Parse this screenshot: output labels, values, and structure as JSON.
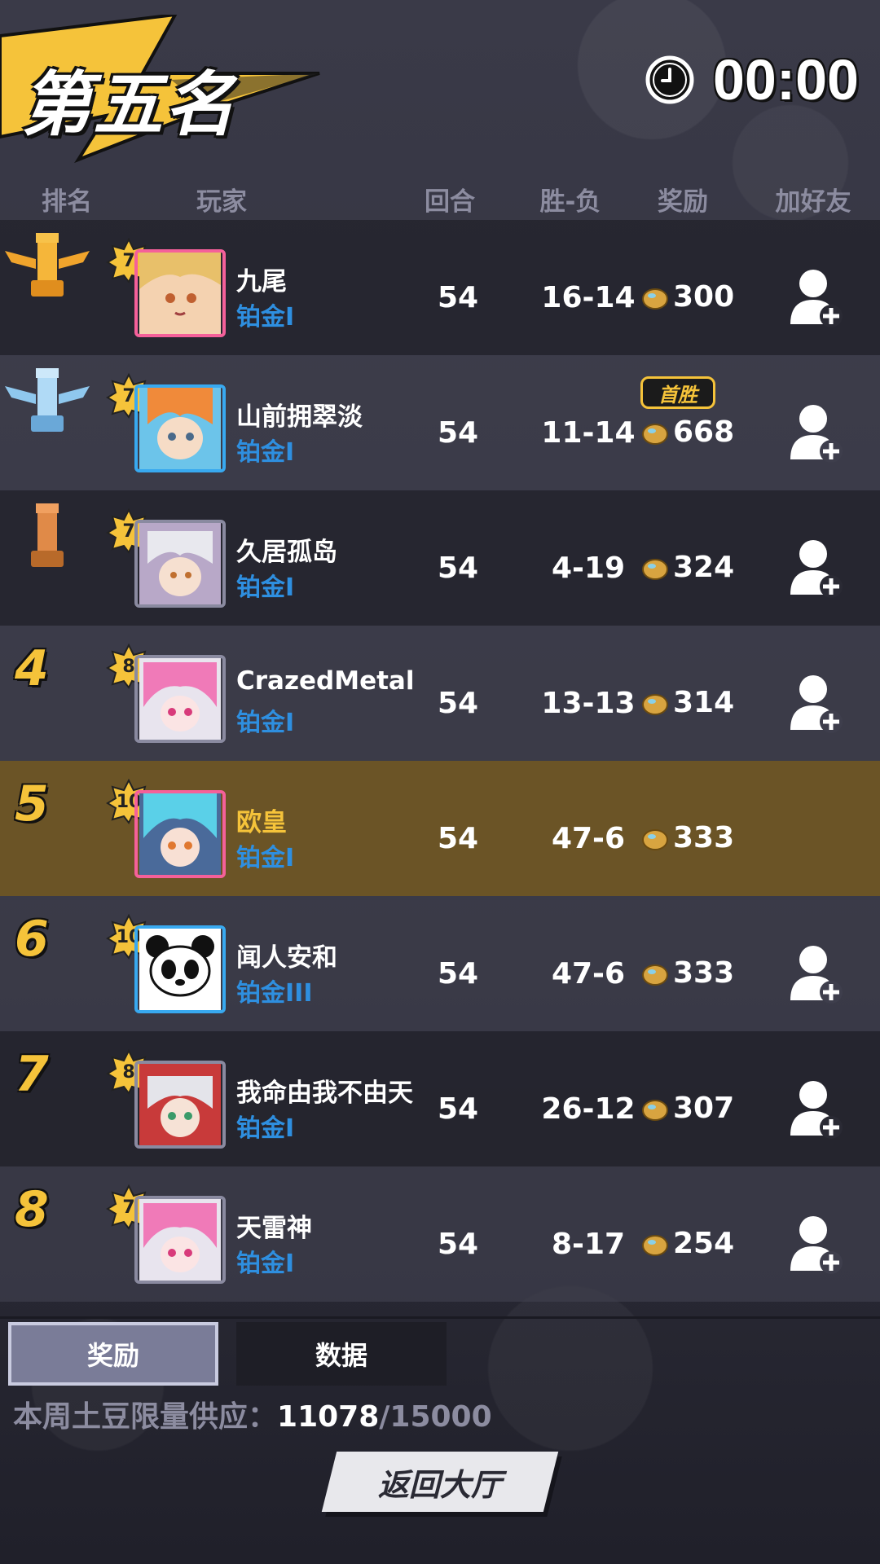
{
  "header": {
    "title": "第五名",
    "timer": "00:00"
  },
  "columns": {
    "rank": "排名",
    "player": "玩家",
    "rounds": "回合",
    "win_loss": "胜-负",
    "reward": "奖励",
    "add_friend": "加好友"
  },
  "players": [
    {
      "rank": "1",
      "trophy": "gold-trophy-icon",
      "level": "7",
      "name": "九尾",
      "tier": "铂金I",
      "rounds": "54",
      "win_loss": "16-14",
      "reward": "300"
    },
    {
      "rank": "2",
      "trophy": "silver-trophy-icon",
      "level": "7",
      "name": "山前拥翠淡",
      "tier": "铂金I",
      "rounds": "54",
      "win_loss": "11-14",
      "reward": "668",
      "badge": "首胜"
    },
    {
      "rank": "3",
      "trophy": "bronze-trophy-icon",
      "level": "7",
      "name": "久居孤岛",
      "tier": "铂金I",
      "rounds": "54",
      "win_loss": "4-19",
      "reward": "324"
    },
    {
      "rank": "4",
      "level": "8",
      "name": "CrazedMetal",
      "tier": "铂金I",
      "rounds": "54",
      "win_loss": "13-13",
      "reward": "314"
    },
    {
      "rank": "5",
      "level": "10",
      "name": "欧皇",
      "tier": "铂金I",
      "rounds": "54",
      "win_loss": "47-6",
      "reward": "333",
      "is_self": true
    },
    {
      "rank": "6",
      "level": "10",
      "name": "闻人安和",
      "tier": "铂金III",
      "rounds": "54",
      "win_loss": "47-6",
      "reward": "333"
    },
    {
      "rank": "7",
      "level": "8",
      "name": "我命由我不由天",
      "tier": "铂金I",
      "rounds": "54",
      "win_loss": "26-12",
      "reward": "307"
    },
    {
      "rank": "8",
      "level": "7",
      "name": "天雷神",
      "tier": "铂金I",
      "rounds": "54",
      "win_loss": "8-17",
      "reward": "254"
    }
  ],
  "tabs": {
    "rewards": "奖励",
    "stats": "数据"
  },
  "supply": {
    "label": "本周土豆限量供应：",
    "current": "11078",
    "max": "/15000"
  },
  "return_button": "返回大厅",
  "colors": {
    "accent_gold": "#f5c33a",
    "tier_blue": "#2e8fe0",
    "highlight_row": "#6b5426",
    "background": "#33333f"
  }
}
